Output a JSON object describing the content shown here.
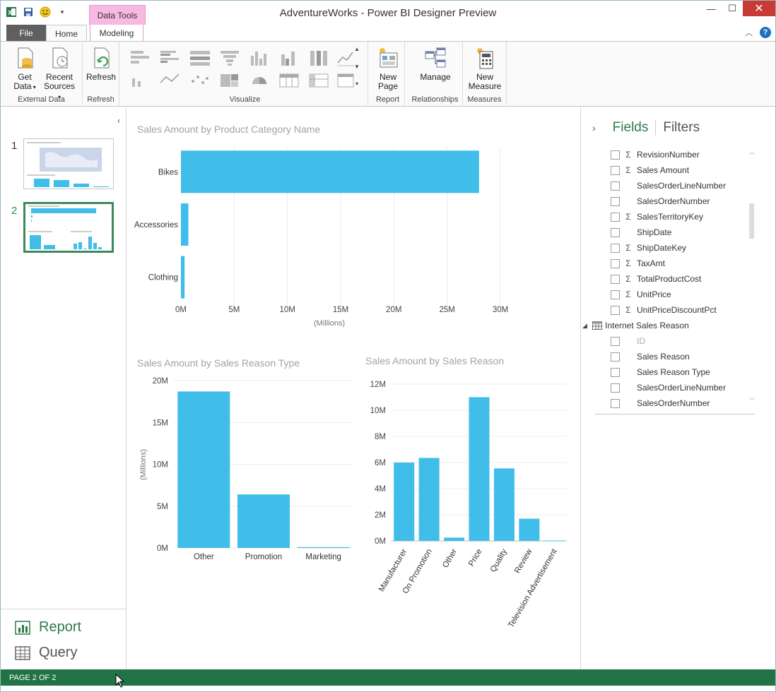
{
  "window": {
    "title": "AdventureWorks - Power BI Designer Preview",
    "context_tab": "Data Tools",
    "controls": {
      "minimize": "—",
      "maximize": "☐",
      "close": "✕"
    }
  },
  "ribbon_tabs": {
    "file": "File",
    "home": "Home",
    "modeling": "Modeling"
  },
  "ribbon": {
    "groups": {
      "external_data": "External Data",
      "refresh": "Refresh",
      "visualize": "Visualize",
      "report": "Report",
      "relationships": "Relationships",
      "measures": "Measures"
    },
    "buttons": {
      "get_data_1": "Get",
      "get_data_2": "Data",
      "recent_sources_1": "Recent",
      "recent_sources_2": "Sources",
      "refresh": "Refresh",
      "new_page_1": "New",
      "new_page_2": "Page",
      "manage": "Manage",
      "new_measure_1": "New",
      "new_measure_2": "Measure"
    }
  },
  "pages": {
    "items": [
      "1",
      "2"
    ],
    "active": "2"
  },
  "views": {
    "report": "Report",
    "query": "Query",
    "active": "Report"
  },
  "status": {
    "text": "PAGE 2 OF 2"
  },
  "colors": {
    "bar": "#41bde9",
    "accent_green": "#217346",
    "title_gray": "#a3a3a3"
  },
  "chart_data": [
    {
      "type": "bar",
      "orientation": "horizontal",
      "title": "Sales Amount by Product Category Name",
      "categories": [
        "Bikes",
        "Accessories",
        "Clothing"
      ],
      "values": [
        28.0,
        0.7,
        0.34
      ],
      "xlabel": "(Millions)",
      "xticks": [
        "0M",
        "5M",
        "10M",
        "15M",
        "20M",
        "25M",
        "30M"
      ],
      "xlim": [
        0,
        30
      ]
    },
    {
      "type": "bar",
      "title": "Sales Amount by Sales Reason Type",
      "categories": [
        "Other",
        "Promotion",
        "Marketing"
      ],
      "values": [
        18.7,
        6.4,
        0.1
      ],
      "ylabel": "(Millions)",
      "yticks": [
        "0M",
        "5M",
        "10M",
        "15M",
        "20M"
      ],
      "ylim": [
        0,
        20
      ]
    },
    {
      "type": "bar",
      "title": "Sales Amount by Sales Reason",
      "categories": [
        "Manufacturer",
        "On Promotion",
        "Other",
        "Price",
        "Quality",
        "Review",
        "Television Advertisement"
      ],
      "values": [
        6.0,
        6.35,
        0.25,
        11.0,
        5.55,
        1.7,
        0.03
      ],
      "yticks": [
        "0M",
        "2M",
        "4M",
        "6M",
        "8M",
        "10M",
        "12M"
      ],
      "ylim": [
        0,
        12
      ]
    }
  ],
  "fields": {
    "tabs": {
      "fields": "Fields",
      "filters": "Filters"
    },
    "items": [
      {
        "name": "RevisionNumber",
        "sigma": true
      },
      {
        "name": "Sales Amount",
        "sigma": true
      },
      {
        "name": "SalesOrderLineNumber",
        "sigma": false
      },
      {
        "name": "SalesOrderNumber",
        "sigma": false
      },
      {
        "name": "SalesTerritoryKey",
        "sigma": true
      },
      {
        "name": "ShipDate",
        "sigma": false
      },
      {
        "name": "ShipDateKey",
        "sigma": true
      },
      {
        "name": "TaxAmt",
        "sigma": true
      },
      {
        "name": "TotalProductCost",
        "sigma": true
      },
      {
        "name": "UnitPrice",
        "sigma": true
      },
      {
        "name": "UnitPriceDiscountPct",
        "sigma": true
      }
    ],
    "table": {
      "name": "Internet Sales Reason"
    },
    "table_items": [
      {
        "name": "ID",
        "dim": true
      },
      {
        "name": "Sales Reason",
        "dim": false
      },
      {
        "name": "Sales Reason Type",
        "dim": false
      },
      {
        "name": "SalesOrderLineNumber",
        "dim": false
      },
      {
        "name": "SalesOrderNumber",
        "dim": false
      }
    ],
    "sigma_symbol": "Σ"
  }
}
